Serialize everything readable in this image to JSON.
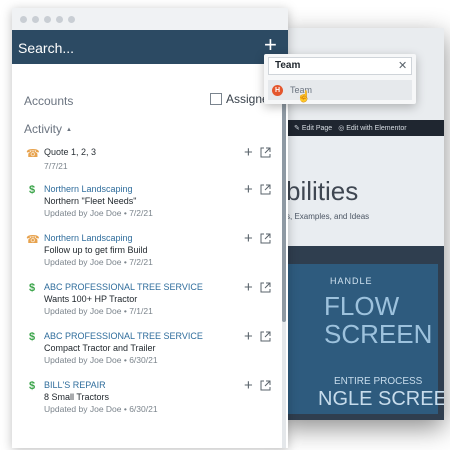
{
  "search": {
    "label": "Search..."
  },
  "sections": {
    "accounts": "Accounts",
    "assigned": "Assigned",
    "activity": "Activity"
  },
  "activities": [
    {
      "icon": "phone-icon",
      "line1": "Quote 1, 2, 3",
      "line1_link": false,
      "line2": "",
      "line3": "7/7/21"
    },
    {
      "icon": "dollar-icon",
      "line1": "Northern Landscaping",
      "line1_link": true,
      "line2": "Northern \"Fleet Needs\"",
      "line3": "Updated by Joe Doe • 7/2/21"
    },
    {
      "icon": "phone-icon",
      "line1": "Northern Landscaping",
      "line1_link": true,
      "line2": "Follow up to get firm Build",
      "line3": "Updated by Joe Doe • 7/2/21"
    },
    {
      "icon": "dollar-icon",
      "line1": "ABC PROFESSIONAL TREE SERVICE",
      "line1_link": true,
      "line2": "Wants 100+ HP Tractor",
      "line3": "Updated by Joe Doe • 7/1/21"
    },
    {
      "icon": "dollar-icon",
      "line1": "ABC PROFESSIONAL TREE SERVICE",
      "line1_link": true,
      "line2": "Compact Tractor and Trailer",
      "line3": "Updated by Joe Doe • 6/30/21"
    },
    {
      "icon": "dollar-icon",
      "line1": "BILL'S REPAIR",
      "line1_link": true,
      "line2": "8 Small Tractors",
      "line3": "Updated by Joe Doe • 6/30/21"
    }
  ],
  "dropdown": {
    "value": "Team",
    "option_badge": "H",
    "option_label": "Team"
  },
  "background": {
    "toolbar_edit_page": "Edit Page",
    "toolbar_edit_elementor": "Edit with Elementor",
    "hero_title": "bilities",
    "hero_subtitle": "s, Examples, and Ideas",
    "banner_handle": "HANDLE",
    "banner_flow": "FLOW",
    "banner_screen": "SCREEN",
    "banner_entire": "ENTIRE PROCESS",
    "banner_single": "NGLE SCREEN"
  },
  "colors": {
    "search_bar": "#2c4a63",
    "link": "#2f6d9c",
    "phone": "#e7a24d",
    "dollar": "#3ba44a",
    "badge": "#e4572e"
  }
}
